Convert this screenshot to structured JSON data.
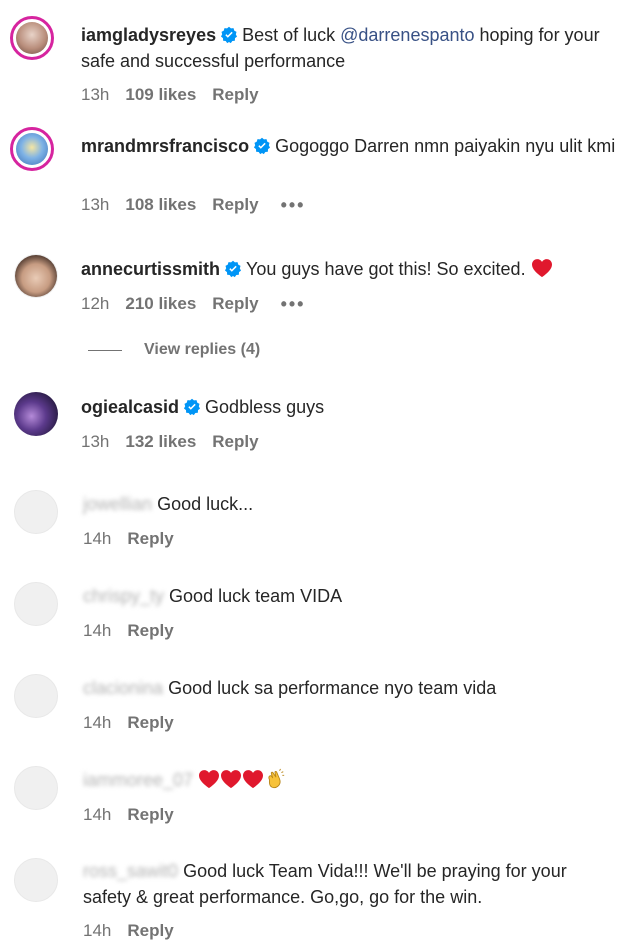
{
  "comments": [
    {
      "username": "iamgladysreyes",
      "verified": true,
      "text_before": "Best of luck ",
      "mention": "@darrenespanto",
      "text_after": " hoping for your safe and successful performance",
      "time": "13h",
      "likes": "109 likes",
      "reply": "Reply"
    },
    {
      "username": "mrandmrsfrancisco",
      "verified": true,
      "text": "Gogoggo Darren nmn paiyakin nyu ulit kmi",
      "time": "13h",
      "likes": "108 likes",
      "reply": "Reply",
      "more": "•••"
    },
    {
      "username": "annecurtissmith",
      "verified": true,
      "text": "You guys have got this! So excited.",
      "emoji": "red-heart",
      "time": "12h",
      "likes": "210 likes",
      "reply": "Reply",
      "more": "•••",
      "view_replies": "View replies (4)"
    },
    {
      "username": "ogiealcasid",
      "verified": true,
      "text": "Godbless guys",
      "time": "13h",
      "likes": "132 likes",
      "reply": "Reply"
    },
    {
      "username": "jowellian",
      "text": "Good luck...",
      "time": "14h",
      "reply": "Reply"
    },
    {
      "username": "chrispy_ty",
      "text": "Good luck team VIDA",
      "time": "14h",
      "reply": "Reply"
    },
    {
      "username": "clacionina",
      "text": "Good luck sa performance nyo team vida",
      "time": "14h",
      "reply": "Reply"
    },
    {
      "username": "iammoree_07",
      "emojis": [
        "red-heart",
        "red-heart",
        "red-heart",
        "clapping-hands"
      ],
      "time": "14h",
      "reply": "Reply"
    },
    {
      "username": "ross_sawit0",
      "text": "Good luck Team Vida!!! We'll be praying for your safety & great performance. Go,go, go for the win.",
      "time": "14h",
      "reply": "Reply"
    }
  ],
  "colors": {
    "text": "#262626",
    "secondary": "#737373",
    "mention": "#385185",
    "verified": "#0095f6",
    "heart": "#e0182d",
    "story_ring": "#d6249f"
  }
}
